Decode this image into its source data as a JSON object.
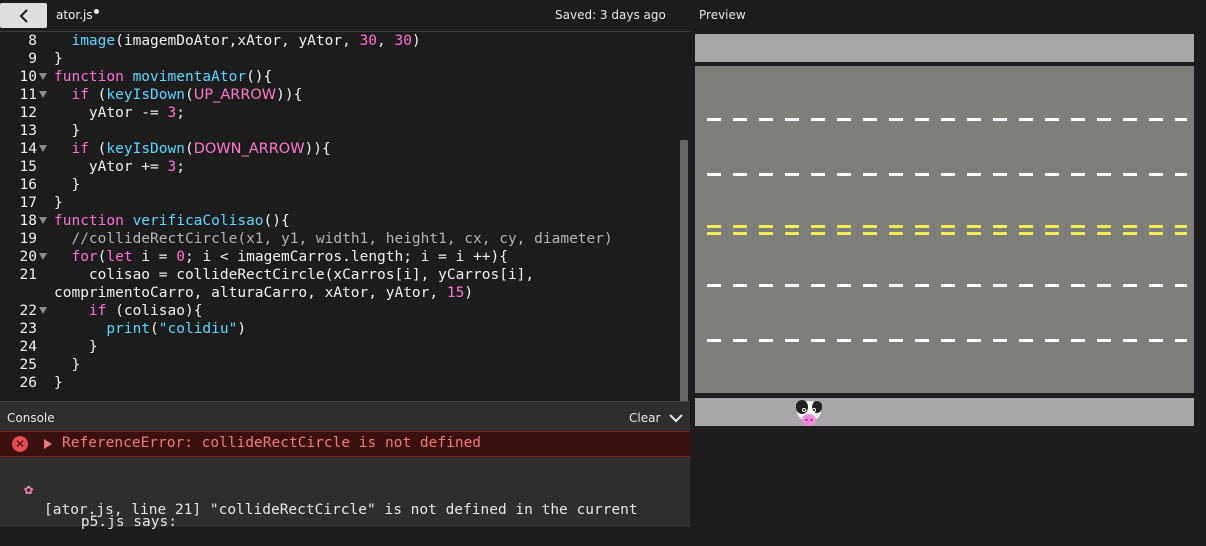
{
  "topbar": {
    "back_label": "‹",
    "file_name": "ator.js",
    "saved_status": "Saved: 3 days ago",
    "preview_title": "Preview"
  },
  "editor": {
    "lines": [
      {
        "num": "8",
        "fold": false,
        "tokens": [
          {
            "t": "  "
          },
          {
            "t": "image",
            "c": "f"
          },
          {
            "t": "(imagemDoAtor,xAtor, yAtor, "
          },
          {
            "t": "30",
            "c": "n"
          },
          {
            "t": ", "
          },
          {
            "t": "30",
            "c": "n"
          },
          {
            "t": ")"
          }
        ]
      },
      {
        "num": "9",
        "fold": false,
        "tokens": [
          {
            "t": "}"
          }
        ]
      },
      {
        "num": "10",
        "fold": true,
        "tokens": [
          {
            "t": "function ",
            "c": "k"
          },
          {
            "t": "movimentaAtor",
            "c": "f"
          },
          {
            "t": "(){"
          }
        ]
      },
      {
        "num": "11",
        "fold": true,
        "tokens": [
          {
            "t": "  "
          },
          {
            "t": "if",
            "c": "k"
          },
          {
            "t": " ("
          },
          {
            "t": "keyIsDown",
            "c": "f"
          },
          {
            "t": "("
          },
          {
            "t": "UP_ARROW",
            "c": "pk"
          },
          {
            "t": ")){"
          }
        ]
      },
      {
        "num": "12",
        "fold": false,
        "tokens": [
          {
            "t": "    yAtor -= "
          },
          {
            "t": "3",
            "c": "n"
          },
          {
            "t": ";"
          }
        ]
      },
      {
        "num": "13",
        "fold": false,
        "tokens": [
          {
            "t": "  }"
          }
        ]
      },
      {
        "num": "14",
        "fold": true,
        "tokens": [
          {
            "t": "  "
          },
          {
            "t": "if",
            "c": "k"
          },
          {
            "t": " ("
          },
          {
            "t": "keyIsDown",
            "c": "f"
          },
          {
            "t": "("
          },
          {
            "t": "DOWN_ARROW",
            "c": "pk"
          },
          {
            "t": ")){"
          }
        ]
      },
      {
        "num": "15",
        "fold": false,
        "tokens": [
          {
            "t": "    yAtor += "
          },
          {
            "t": "3",
            "c": "n"
          },
          {
            "t": ";"
          }
        ]
      },
      {
        "num": "16",
        "fold": false,
        "tokens": [
          {
            "t": "  }"
          }
        ]
      },
      {
        "num": "17",
        "fold": false,
        "tokens": [
          {
            "t": "}"
          }
        ]
      },
      {
        "num": "18",
        "fold": true,
        "tokens": [
          {
            "t": "function ",
            "c": "k"
          },
          {
            "t": "verificaColisao",
            "c": "f"
          },
          {
            "t": "(){"
          }
        ]
      },
      {
        "num": "19",
        "fold": false,
        "tokens": [
          {
            "t": "  "
          },
          {
            "t": "//collideRectCircle(x1, y1, width1, height1, cx, cy, diameter)",
            "c": "c"
          }
        ]
      },
      {
        "num": "20",
        "fold": true,
        "tokens": [
          {
            "t": "  "
          },
          {
            "t": "for",
            "c": "k"
          },
          {
            "t": "("
          },
          {
            "t": "let",
            "c": "k"
          },
          {
            "t": " i = "
          },
          {
            "t": "0",
            "c": "n"
          },
          {
            "t": "; i < imagemCarros.length; i = i ++){"
          }
        ]
      },
      {
        "num": "21",
        "fold": false,
        "tokens": [
          {
            "t": "    colisao = collideRectCircle(xCarros[i], yCarros[i],"
          }
        ]
      },
      {
        "num": "",
        "fold": false,
        "tokens": [
          {
            "t": "comprimentoCarro, alturaCarro, xAtor, yAtor, "
          },
          {
            "t": "15",
            "c": "n"
          },
          {
            "t": ")"
          }
        ]
      },
      {
        "num": "22",
        "fold": true,
        "tokens": [
          {
            "t": "    "
          },
          {
            "t": "if",
            "c": "k"
          },
          {
            "t": " (colisao){"
          }
        ]
      },
      {
        "num": "23",
        "fold": false,
        "tokens": [
          {
            "t": "      "
          },
          {
            "t": "print",
            "c": "f"
          },
          {
            "t": "("
          },
          {
            "t": "\"colidiu\"",
            "c": "s"
          },
          {
            "t": ")"
          }
        ]
      },
      {
        "num": "24",
        "fold": false,
        "tokens": [
          {
            "t": "    }"
          }
        ]
      },
      {
        "num": "25",
        "fold": false,
        "tokens": [
          {
            "t": "  }"
          }
        ]
      },
      {
        "num": "26",
        "fold": false,
        "tokens": [
          {
            "t": "}"
          }
        ]
      }
    ]
  },
  "console": {
    "title": "Console",
    "clear_label": "Clear",
    "error_icon": "✕",
    "error_text": "ReferenceError: collideRectCircle is not defined",
    "p5_says": "p5.js says:",
    "p5_message": "[ator.js, line 21] \"collideRectCircle\" is not defined in the current"
  },
  "preview": {
    "colors": {
      "sidewalk": "#a8a6a8",
      "road": "#7e7e7b",
      "white_line": "#ffffff",
      "yellow_line": "#f2ec52"
    },
    "icons": [
      "cow-sprite-icon"
    ]
  }
}
